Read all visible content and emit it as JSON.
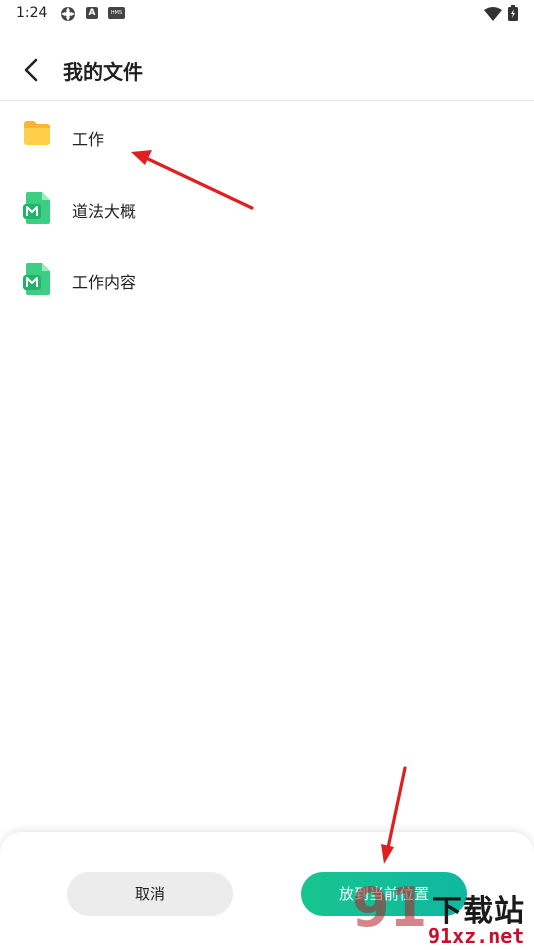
{
  "status_bar": {
    "time": "1:24",
    "icons": [
      "gear-notification-icon",
      "a-badge-icon",
      "hms-badge-icon",
      "wifi-icon",
      "battery-icon"
    ],
    "badge_a": "A",
    "badge_hms": "HMS"
  },
  "header": {
    "back_icon": "chevron-left-icon",
    "title": "我的文件"
  },
  "files": [
    {
      "name": "工作",
      "icon": "folder-icon",
      "icon_color": "#ffc93c"
    },
    {
      "name": "道法大概",
      "icon": "mind-map-file-icon",
      "icon_color": "#2fc57a"
    },
    {
      "name": "工作内容",
      "icon": "mind-map-file-icon",
      "icon_color": "#2fc57a"
    }
  ],
  "actions": {
    "cancel_label": "取消",
    "confirm_label": "放到当前位置"
  },
  "watermark": {
    "number": "91",
    "text": "下载站",
    "domain": "91xz.net"
  },
  "colors": {
    "accent": "#14c196",
    "annotation_arrow": "#e02020"
  }
}
